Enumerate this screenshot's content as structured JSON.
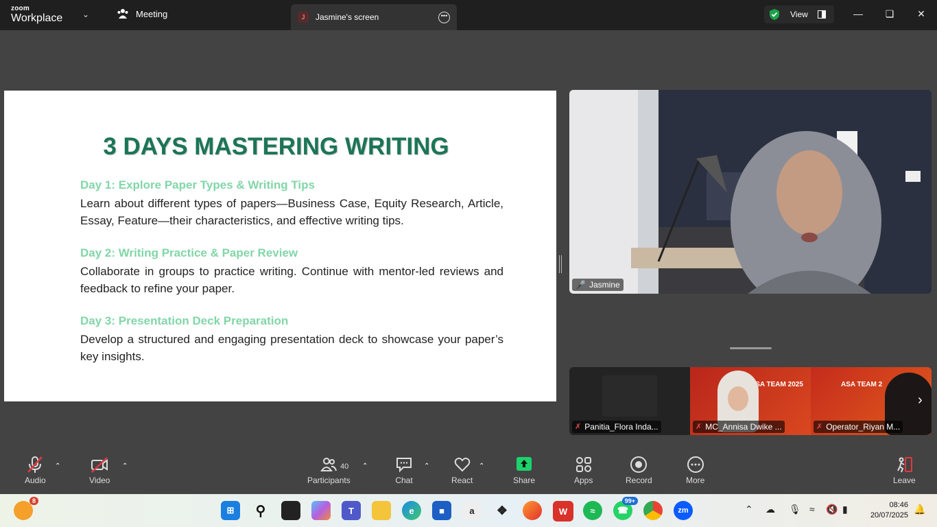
{
  "titlebar": {
    "brand_top": "zoom",
    "brand_bottom": "Workplace",
    "meeting_tab": "Meeting",
    "screen_tab_avatar": "J",
    "screen_tab": "Jasmine's screen",
    "view_label": "View",
    "shield_color": "#1aa34a"
  },
  "slide": {
    "title": "3 DAYS MASTERING WRITING",
    "days": [
      {
        "heading": "Day 1: Explore Paper Types & Writing Tips",
        "body": " Learn about different types of papers—Business Case, Equity Research, Article, Essay, Feature—their characteristics, and effective writing tips."
      },
      {
        "heading": "Day 2: Writing Practice & Paper Review",
        "body": " Collaborate in groups to practice writing. Continue with mentor-led reviews and feedback to refine your paper."
      },
      {
        "heading": "Day 3: Presentation Deck Preparation",
        "body": "Develop a structured and engaging presentation deck to showcase your paper’s key insights."
      }
    ],
    "title_color": "#1b7556",
    "heading_color": "#82d6a8"
  },
  "speaker": {
    "name": "Jasmine"
  },
  "thumbnails": [
    {
      "name": "Panitia_Flora Inda..."
    },
    {
      "name": "MC_Annisa Dwike ...",
      "banner": "ASA TEAM 2025"
    },
    {
      "name": "Operator_Riyan M...",
      "banner": "ASA TEAM 2"
    }
  ],
  "toolbar": {
    "audio": "Audio",
    "video": "Video",
    "participants": "Participants",
    "participants_count": "40",
    "chat": "Chat",
    "react": "React",
    "share": "Share",
    "apps": "Apps",
    "record": "Record",
    "more": "More",
    "leave": "Leave",
    "share_color": "#1bd36a"
  },
  "taskbar": {
    "notif_badge": "8",
    "whatsapp_badge": "99+",
    "time": "08:46",
    "date": "20/07/2025"
  }
}
